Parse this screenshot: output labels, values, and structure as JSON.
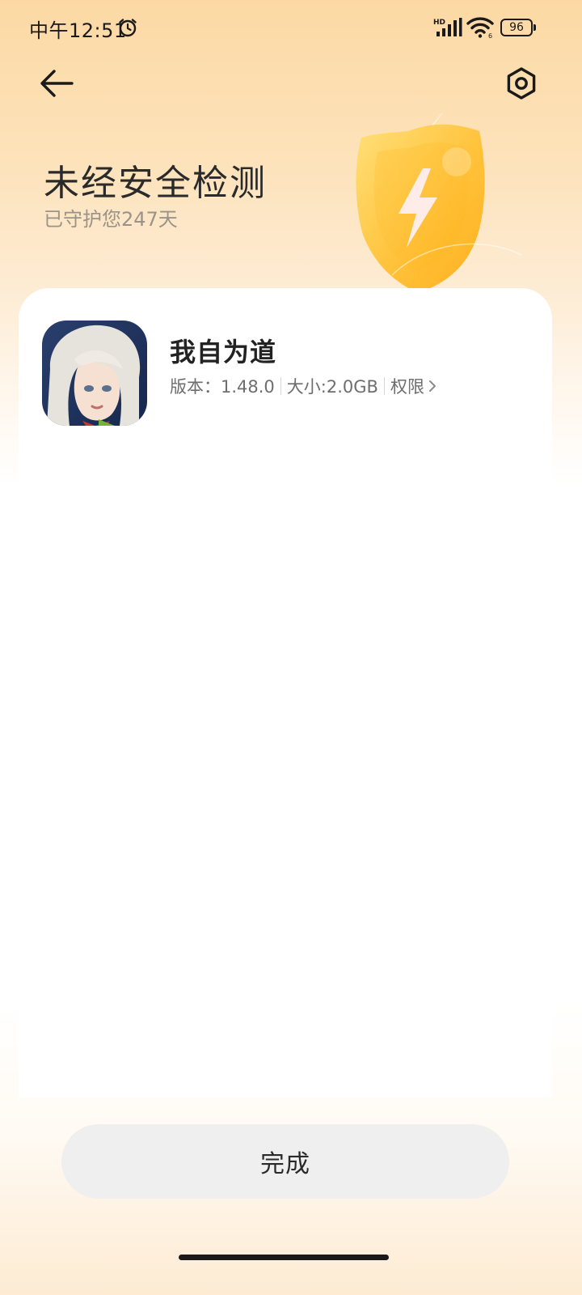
{
  "status_bar": {
    "time": "中午12:51",
    "network_badge": "HD",
    "wifi_badge": "6",
    "battery_level": "96"
  },
  "header": {
    "title": "未经安全检测",
    "subtitle": "已守护您247天"
  },
  "app": {
    "name": "我自为道",
    "version_text": "版本：1.48.0",
    "size_text": "大小:2.0GB",
    "permissions_label": "权限"
  },
  "actions": {
    "done_label": "完成"
  },
  "colors": {
    "header_gradient_top": "#fcd9a4",
    "shield_yellow": "#ffc23a",
    "button_bg": "#efefef"
  },
  "icons": [
    "alarm-icon",
    "signal-icon",
    "wifi-icon",
    "battery-icon",
    "back-arrow-icon",
    "settings-icon",
    "shield-lightning-icon",
    "chevron-right-icon"
  ]
}
